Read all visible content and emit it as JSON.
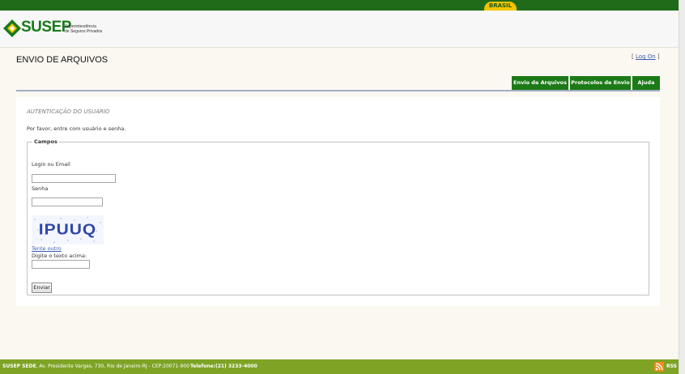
{
  "gov_bar": {
    "label": "BRASIL"
  },
  "logo": {
    "name": "SUSEP",
    "subtitle": "Superintendência\nde Seguros Privados"
  },
  "page": {
    "title": "ENVIO DE ARQUIVOS"
  },
  "logon": {
    "open": "[ ",
    "link": "Log On",
    "close": " ]"
  },
  "tabs": [
    {
      "label": "Envio de Arquivos"
    },
    {
      "label": "Protocolos de Envio"
    },
    {
      "label": "Ajuda"
    }
  ],
  "auth": {
    "title": "AUTENTICAÇÃO DO USUÁRIO",
    "intro": "Por favor, entre com usuário e senha.",
    "legend": "Campos",
    "login_label": "Login ou Email",
    "login_value": "",
    "password_label": "Senha",
    "password_value": "",
    "captcha_text": "IPUUQ",
    "retry_link": "Tente outro",
    "captcha_prompt": "Digite o texto acima:",
    "captcha_value": "",
    "submit_label": "Enviar"
  },
  "footer": {
    "sede": "SUSEP SEDE",
    "address": ", Av. Presidente Vargas, 730, Rio de Janeiro-RJ  -  CEP:20071-900",
    "phone": "Telefone:(21) 3233-4000",
    "rss": "RSS"
  },
  "colors": {
    "gov_green": "#1f6b1a",
    "brasil_yellow": "#f2c400",
    "tab_green": "#1c7a17",
    "footer_green": "#7ea325",
    "link_blue": "#3a5ab0"
  }
}
